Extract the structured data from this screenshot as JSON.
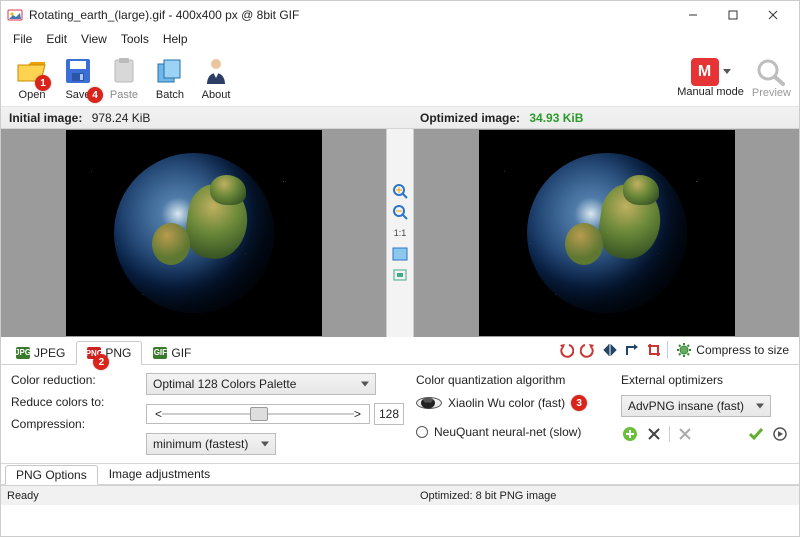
{
  "window": {
    "title": "Rotating_earth_(large).gif - 400x400 px @ 8bit GIF",
    "min_icon": "minimize-icon",
    "max_icon": "maximize-icon",
    "close_icon": "close-icon"
  },
  "menu": {
    "items": [
      "File",
      "Edit",
      "View",
      "Tools",
      "Help"
    ]
  },
  "toolbar": {
    "open": "Open",
    "save": "Save",
    "paste": "Paste",
    "batch": "Batch",
    "about": "About",
    "manual_mode": "Manual mode",
    "manual_badge": "M",
    "preview": "Preview"
  },
  "callouts": {
    "open": "1",
    "save": "4",
    "png_tab": "2",
    "xiaolin": "3"
  },
  "sizes": {
    "initial_label": "Initial image:",
    "initial_value": "978.24 KiB",
    "optimized_label": "Optimized image:",
    "optimized_value": "34.93 KiB"
  },
  "center_tools": {
    "zoom_in": "zoom-in-icon",
    "zoom_out": "zoom-out-icon",
    "one_to_one": "1:1",
    "fit": "fit-icon",
    "pan": "pan-icon"
  },
  "format_tabs": {
    "jpeg": "JPEG",
    "png": "PNG",
    "gif": "GIF"
  },
  "right_actions": {
    "compress_label": "Compress to size"
  },
  "options": {
    "color_reduction_label": "Color reduction:",
    "color_reduction_value": "Optimal 128 Colors Palette",
    "reduce_colors_label": "Reduce colors to:",
    "reduce_colors_value": "128",
    "slider_lt": "<",
    "slider_gt": ">",
    "compression_label": "Compression:",
    "compression_value": "minimum (fastest)",
    "quant_header": "Color quantization algorithm",
    "xiaolin_label": "Xiaolin Wu color (fast)",
    "neuquant_label": "NeuQuant neural-net (slow)",
    "ext_header": "External optimizers",
    "ext_value": "AdvPNG insane (fast)"
  },
  "subtabs": {
    "png_options": "PNG Options",
    "image_adjustments": "Image adjustments"
  },
  "status": {
    "ready": "Ready",
    "center": "Optimized: 8 bit PNG image"
  },
  "colors": {
    "accent_green": "#2a9a2a",
    "callout_red": "#d9231b",
    "manual_red": "#e63434"
  }
}
